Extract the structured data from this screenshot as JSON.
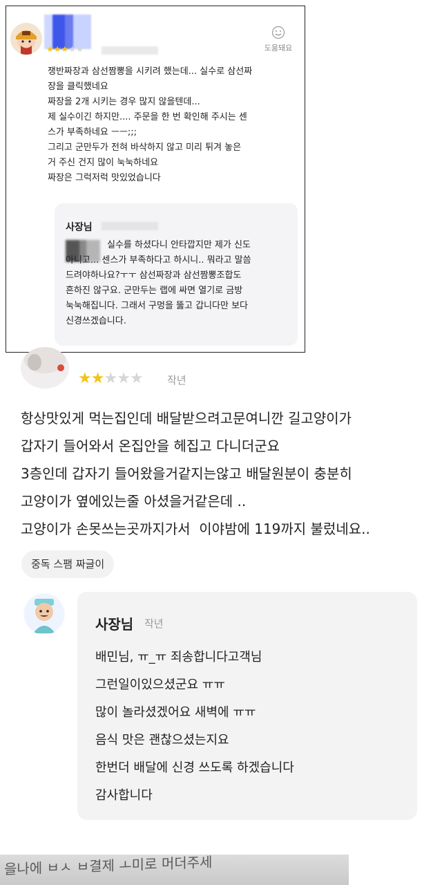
{
  "review1": {
    "rating": 3,
    "max_rating": 5,
    "helpful_label": "도움돼요",
    "body": "쟁반짜장과 삼선짬뽕을 시키려 했는데... 실수로 삼선짜\n장을 클릭했네요\n짜장을 2개 시키는 경우 많지 않을텐데...\n제 실수이긴 하지만.... 주문을 한 번 확인해 주시는 센\n스가 부족하네요 ㅡㅡ;;;\n그리고 군만두가 전혀 바삭하지 않고 미리 튀겨 놓은\n거 주신 건지 많이 눅눅하네요\n짜장은 그럭저럭 맛있었습니다",
    "reply": {
      "author": "사장님",
      "body": "실수를 하셨다니 안타깝지만 제가 신도\n아니고... 센스가 부족하다고 하시니.. 뭐라고 말씀\n드려야하나요?ㅜㅜ 삼선짜장과 삼선짬뽕조합도\n흔하진 않구요. 군만두는 랩에 싸면 열기로 금방\n눅눅해집니다. 그래서 구멍을 뚫고 갑니다만 보다\n신경쓰겠습니다."
    }
  },
  "review2": {
    "rating": 2,
    "max_rating": 5,
    "date": "작년",
    "body": "항상맛있게 먹는집인데 배달받으려고문여니깐 길고양이가\n갑자기 들어와서 온집안을 헤집고 다니더군요\n3층인데 갑자기 들어왔을거같지는않고 배달원분이 충분히\n고양이가 옆에있는줄 아셨을거같은데 ..\n고양이가 손못쓰는곳까지가서  이야밤에 119까지 불렀네요..",
    "tag": "중독 스팸 짜글이",
    "reply": {
      "author": "사장님",
      "date": "작년",
      "body": "배민님, ㅠ_ㅠ 죄송합니다고객님\n그런일이있으셨군요 ㅠㅠ\n많이 놀라셨겠어요 새벽에 ㅠㅠ\n음식 맛은 괜찮으셨는지요\n한번더 배달에 신경 쓰도록 하겠습니다\n감사합니다"
    }
  },
  "photo": {
    "text": "을나에 ㅂㅅ  ㅂ결제   ㅗ미로 머더주세"
  },
  "colors": {
    "star": "#f3c31a",
    "star_empty": "#d6d6d6",
    "muted": "#9a9a9a",
    "reply_bg": "#f3f3f3"
  }
}
